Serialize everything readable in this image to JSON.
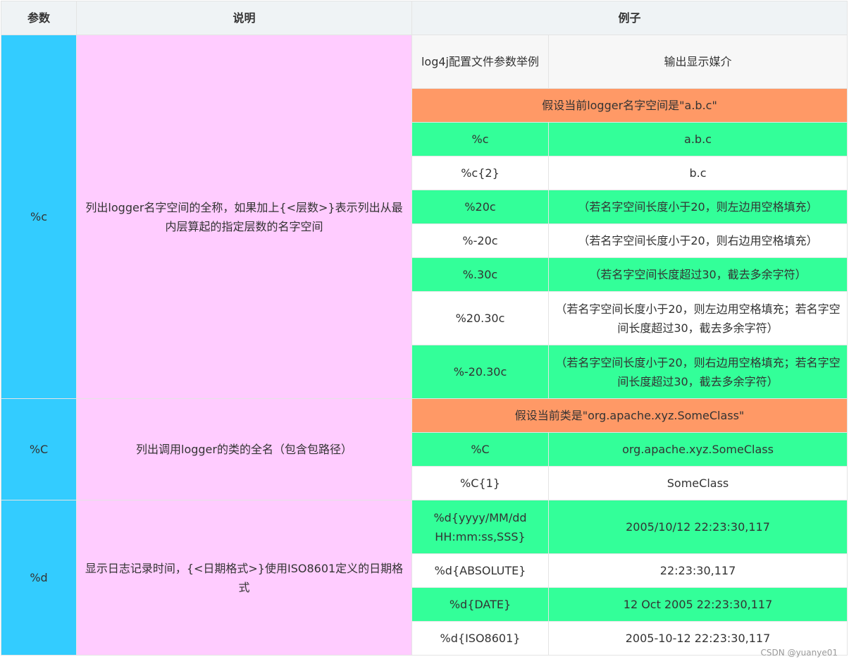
{
  "table": {
    "headers": [
      "参数",
      "说明",
      "例子"
    ],
    "subheaders": [
      "log4j配置文件参数举例",
      "输出显示媒介"
    ],
    "groups": [
      {
        "param": "%c",
        "desc": "列出logger名字空间的全称，如果加上{<层数>}表示列出从最内层算起的指定层数的名字空间",
        "assumption": "假设当前logger名字空间是\"a.b.c\"",
        "rows": [
          [
            "%c",
            "a.b.c"
          ],
          [
            "%c{2}",
            "b.c"
          ],
          [
            "%20c",
            "（若名字空间长度小于20，则左边用空格填充）"
          ],
          [
            "%-20c",
            "（若名字空间长度小于20，则右边用空格填充）"
          ],
          [
            "%.30c",
            "（若名字空间长度超过30，截去多余字符）"
          ],
          [
            "%20.30c",
            "（若名字空间长度小于20，则左边用空格填充；若名字空间长度超过30，截去多余字符）"
          ],
          [
            "%-20.30c",
            "（若名字空间长度小于20，则右边用空格填充；若名字空间长度超过30，截去多余字符）"
          ]
        ]
      },
      {
        "param": "%C",
        "desc": "列出调用logger的类的全名（包含包路径）",
        "assumption": "假设当前类是\"org.apache.xyz.SomeClass\"",
        "rows": [
          [
            "%C",
            "org.apache.xyz.SomeClass"
          ],
          [
            "%C{1}",
            "SomeClass"
          ]
        ]
      },
      {
        "param": "%d",
        "desc": "显示日志记录时间，{<日期格式>}使用ISO8601定义的日期格式",
        "rows": [
          [
            "%d{yyyy/MM/dd HH:mm:ss,SSS}",
            "2005/10/12 22:23:30,117"
          ],
          [
            "%d{ABSOLUTE}",
            "22:23:30,117"
          ],
          [
            "%d{DATE}",
            "12 Oct 2005 22:23:30,117"
          ],
          [
            "%d{ISO8601}",
            "2005-10-12 22:23:30,117"
          ]
        ]
      }
    ]
  },
  "colors": {
    "header_bg": "#eff3f5",
    "param_bg": "#33ccff",
    "desc_bg": "#ffccff",
    "assumption_bg": "#ff9966",
    "green_row_bg": "#33ff99",
    "white_row_bg": "#ffffff"
  },
  "watermark": "CSDN @yuanye01"
}
